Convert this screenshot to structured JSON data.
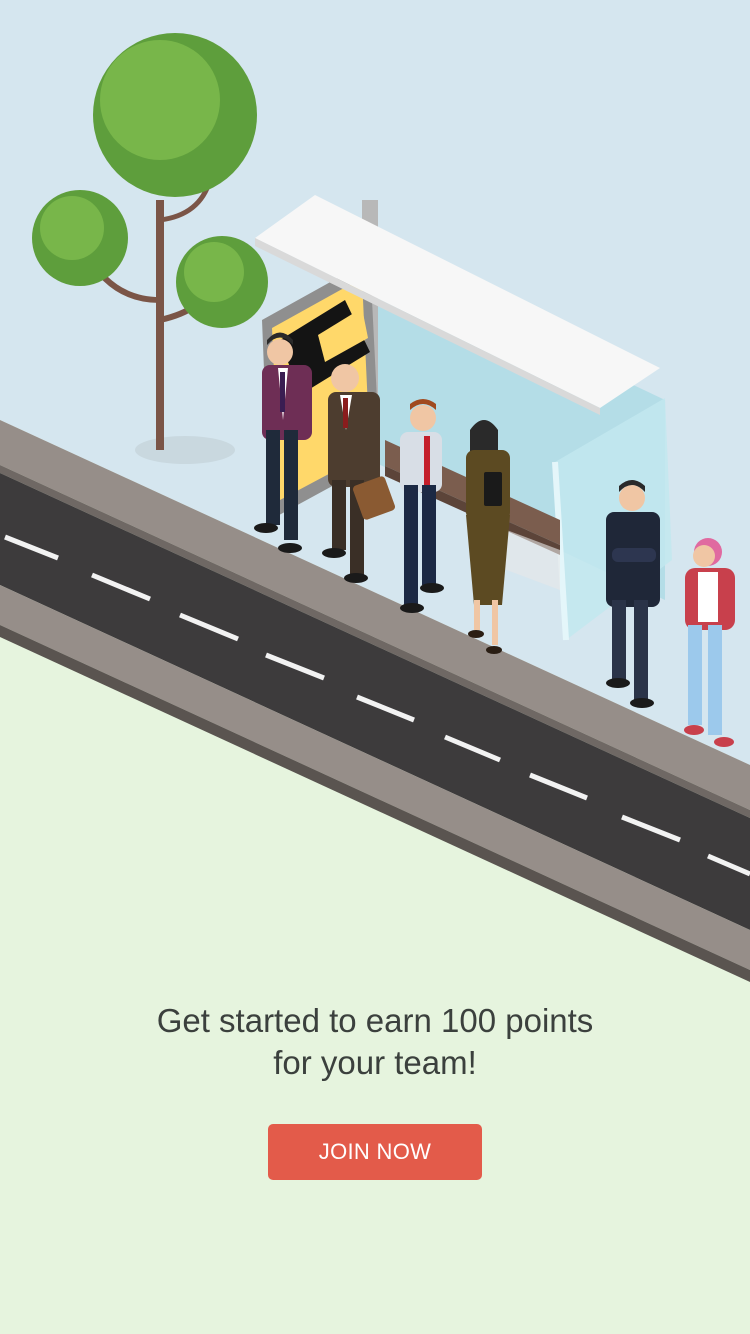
{
  "promo": {
    "line1": "Get started to earn 100 points",
    "line2": "for your team!",
    "button_label": "JOIN NOW"
  },
  "colors": {
    "sky": "#d5e6ef",
    "grass": "#e6f4de",
    "road": "#3d3b3c",
    "sidewalk": "#968e89",
    "button": "#e35b4a",
    "button_text": "#ffffff",
    "text": "#3b403d"
  }
}
